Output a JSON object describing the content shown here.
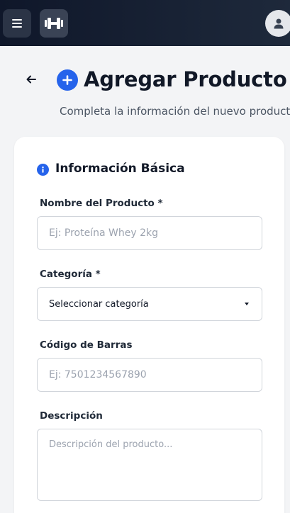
{
  "topbar": {
    "menu_icon": "menu-icon",
    "logo_icon": "dumbbell-icon",
    "avatar_icon": "user-icon"
  },
  "header": {
    "back_icon": "arrow-left-icon",
    "title_icon": "plus-circle-icon",
    "title": "Agregar Producto",
    "subtitle": "Completa la información del nuevo producto"
  },
  "section": {
    "icon": "info-icon",
    "title": "Información Básica"
  },
  "form": {
    "name_label": "Nombre del Producto *",
    "name_placeholder": "Ej: Proteína Whey 2kg",
    "name_value": "",
    "category_label": "Categoría *",
    "category_selected": "Seleccionar categoría",
    "barcode_label": "Código de Barras",
    "barcode_placeholder": "Ej: 7501234567890",
    "barcode_value": "",
    "description_label": "Descripción",
    "description_placeholder": "Descripción del producto...",
    "description_value": ""
  },
  "colors": {
    "accent": "#2563eb",
    "topbar": "#0f172a",
    "background": "#f3f4f6"
  }
}
